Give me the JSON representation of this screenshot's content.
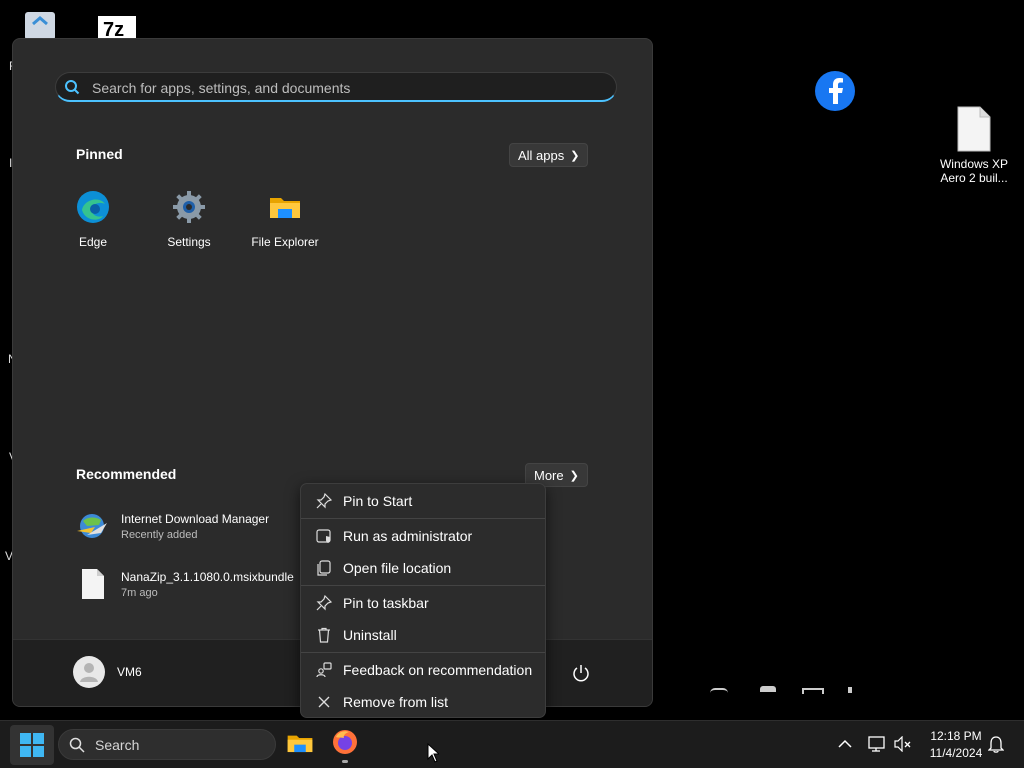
{
  "desktop": {
    "icons": [
      {
        "label": "Windows XP Aero 2 buil..."
      }
    ],
    "edge_letters": [
      "F",
      "I",
      "N",
      "V",
      "V"
    ]
  },
  "start_menu": {
    "search_placeholder": "Search for apps, settings, and documents",
    "pinned_title": "Pinned",
    "all_apps_label": "All apps",
    "pinned_apps": [
      {
        "label": "Edge",
        "icon": "edge-icon"
      },
      {
        "label": "Settings",
        "icon": "settings-gear-icon"
      },
      {
        "label": "File Explorer",
        "icon": "folder-icon"
      }
    ],
    "recommended_title": "Recommended",
    "more_label": "More",
    "recommended": [
      {
        "title": "Internet Download Manager",
        "subtitle": "Recently added",
        "icon": "idm-globe-icon"
      },
      {
        "title": "NanaZip_3.1.1080.0.msixbundle",
        "subtitle": "7m ago",
        "icon": "file-icon"
      }
    ],
    "user_name": "VM6"
  },
  "context_menu": {
    "items": [
      {
        "label": "Pin to Start",
        "icon": "pin-icon"
      },
      {
        "label": "Run as administrator",
        "icon": "shield-window-icon"
      },
      {
        "label": "Open file location",
        "icon": "folder-location-icon"
      },
      {
        "label": "Pin to taskbar",
        "icon": "pin-icon"
      },
      {
        "label": "Uninstall",
        "icon": "trash-icon"
      },
      {
        "label": "Feedback on recommendation",
        "icon": "feedback-icon"
      },
      {
        "label": "Remove from list",
        "icon": "close-icon"
      }
    ]
  },
  "taskbar": {
    "search_label": "Search",
    "time": "12:18 PM",
    "date": "11/4/2024"
  },
  "colors": {
    "accent": "#4cc2ff",
    "start_bg": "#2b2b2b",
    "taskbar_bg": "#1c1c1c"
  }
}
